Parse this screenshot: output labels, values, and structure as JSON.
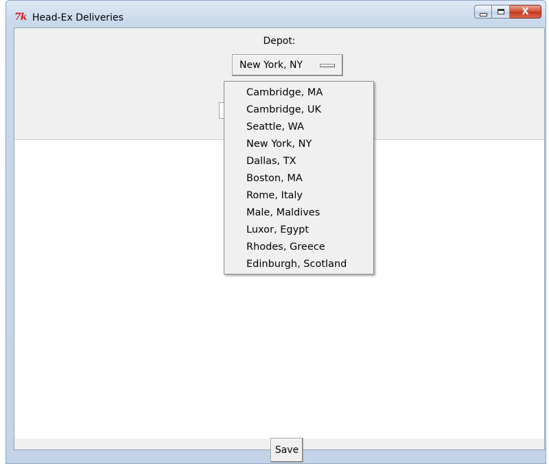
{
  "window": {
    "title": "Head-Ex Deliveries",
    "icon": "tk-feather-icon",
    "controls": [
      "minimize-icon",
      "maximize-icon",
      "close-icon"
    ],
    "close_glyph": "X"
  },
  "depot": {
    "label": "Depot:",
    "selected": "New York, NY",
    "options": [
      "Cambridge, MA",
      "Cambridge, UK",
      "Seattle, WA",
      "New York, NY",
      "Dallas, TX",
      "Boston, MA",
      "Rome, Italy",
      "Male, Maldives",
      "Luxor, Egypt",
      "Rhodes, Greece",
      "Edinburgh, Scotland"
    ]
  },
  "actions": {
    "save_label": "Save"
  },
  "colors": {
    "accent_close": "#c3361d",
    "app_icon": "#d11b1b"
  }
}
